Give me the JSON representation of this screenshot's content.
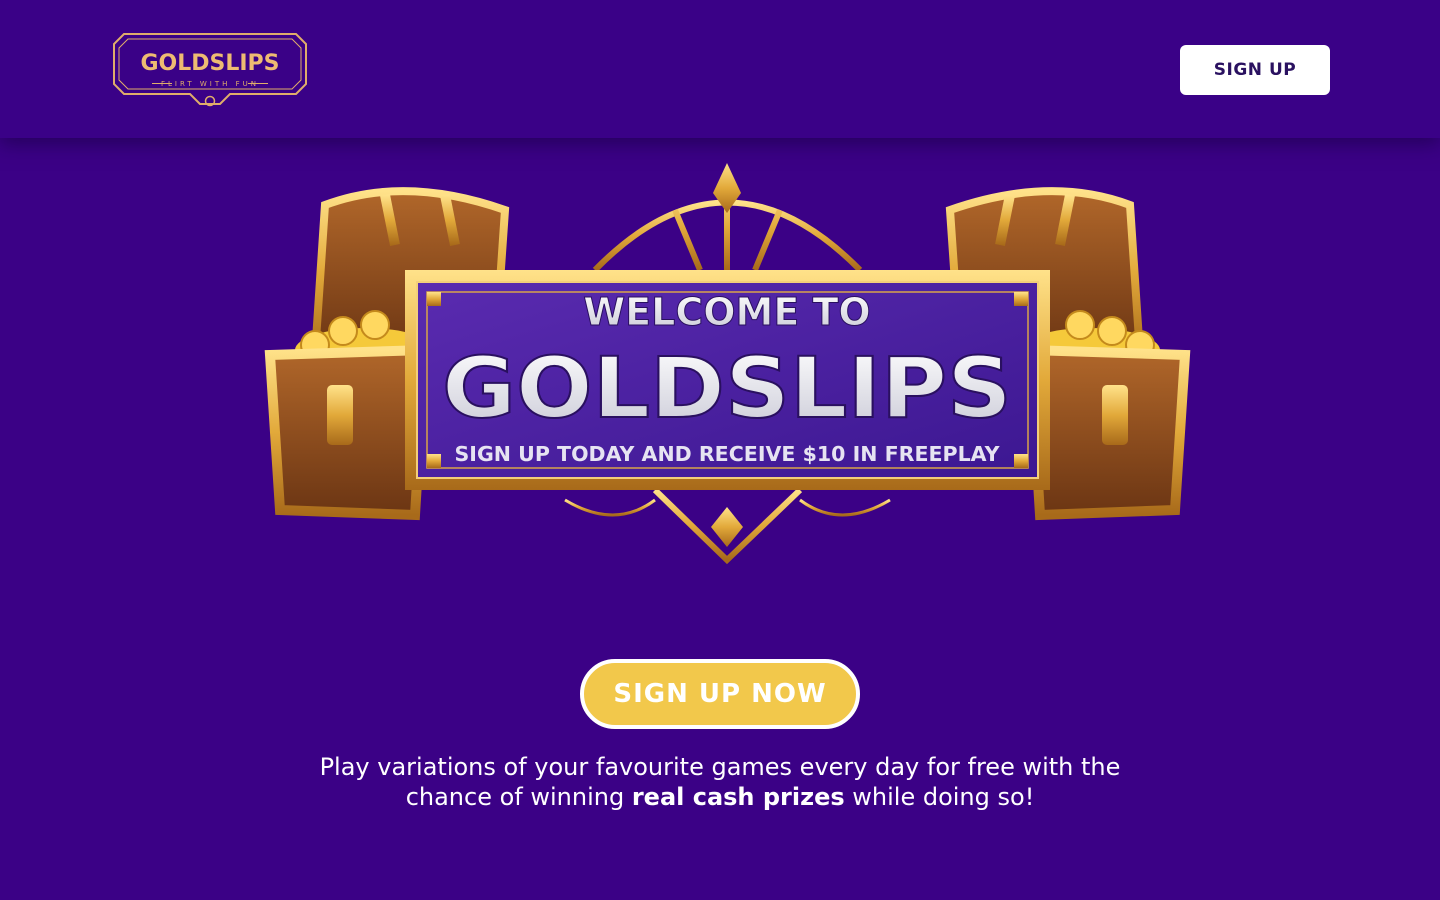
{
  "header": {
    "logo": {
      "brand": "GOLDSLIPS",
      "tagline": "FLIRT WITH FUN"
    },
    "signup_label": "SIGN UP"
  },
  "hero": {
    "line1": "WELCOME TO",
    "title": "GOLDSLIPS",
    "subtitle": "SIGN UP TODAY AND RECEIVE $10 IN FREEPLAY"
  },
  "cta": {
    "label": "SIGN UP NOW"
  },
  "description": {
    "part1": "Play variations of your favourite games every day for free with the chance of winning ",
    "bold": "real cash prizes",
    "part2": " while doing so!"
  },
  "colors": {
    "background": "#3b0186",
    "gold": "#f2c84b",
    "logo_gold": "#e8b86b",
    "button_text": "#2a1160"
  }
}
